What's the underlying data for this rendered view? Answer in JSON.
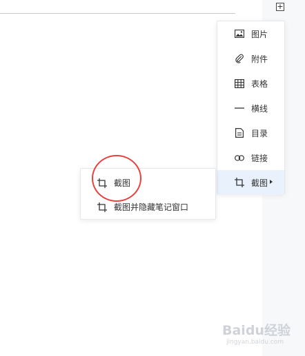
{
  "toolbar": {
    "add_label": "+"
  },
  "insert_menu": {
    "items": [
      {
        "label": "图片",
        "icon": "image-icon"
      },
      {
        "label": "附件",
        "icon": "paperclip-icon"
      },
      {
        "label": "表格",
        "icon": "table-icon"
      },
      {
        "label": "横线",
        "icon": "horizontal-line-icon"
      },
      {
        "label": "目录",
        "icon": "document-icon"
      },
      {
        "label": "链接",
        "icon": "link-icon"
      },
      {
        "label": "截图",
        "icon": "crop-icon",
        "active": true,
        "has_submenu": true
      }
    ]
  },
  "screenshot_submenu": {
    "items": [
      {
        "label": "截图",
        "icon": "crop-icon"
      },
      {
        "label": "截图并隐藏笔记窗口",
        "icon": "crop-icon"
      }
    ]
  },
  "annotation": {
    "color": "#e8403d"
  },
  "watermark": {
    "logo_text": "Baidu经验",
    "url": "jingyan.baidu.com"
  },
  "colors": {
    "active_item_bg": "#e8f1fc",
    "menu_border": "#e4e7ec",
    "text": "#333333"
  }
}
